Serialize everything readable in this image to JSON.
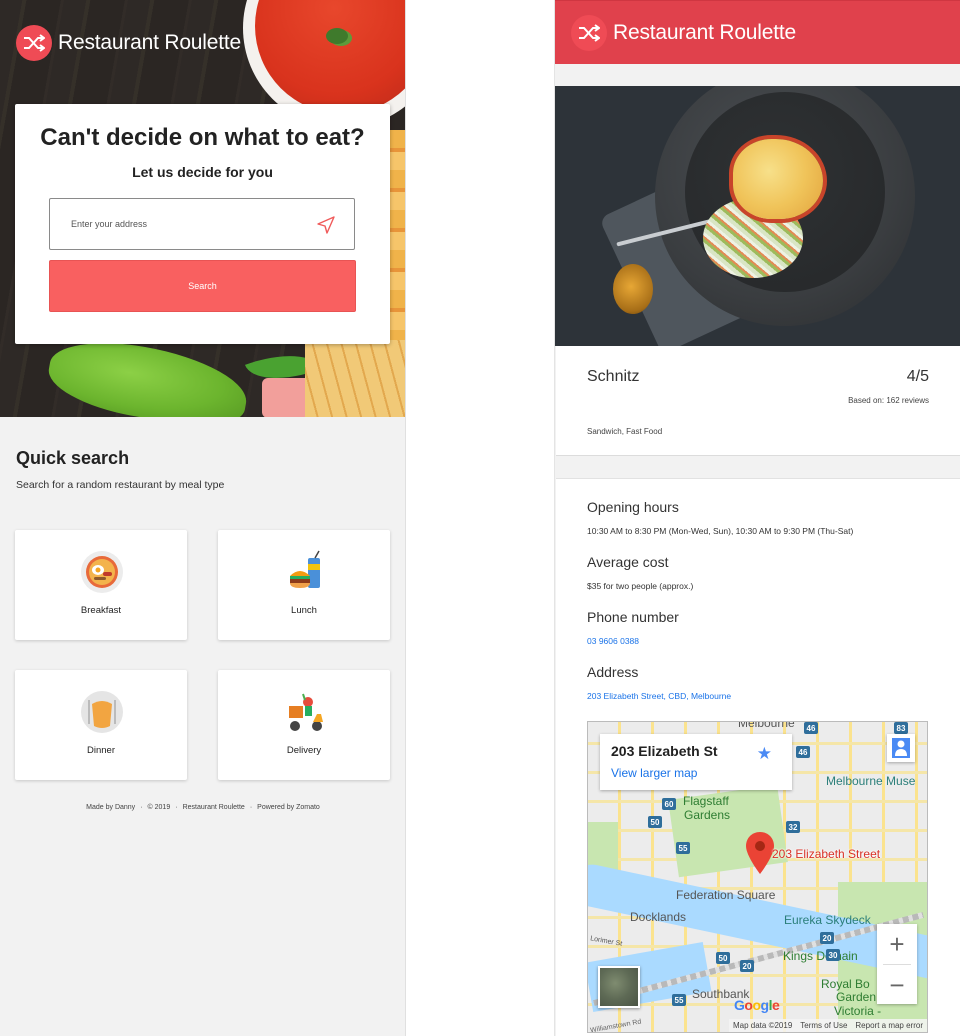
{
  "left": {
    "header": {
      "app_name": "Restaurant Roulette",
      "logo_icon": "shuffle-icon"
    },
    "hero": {
      "title": "Can't decide on what to eat?",
      "subtitle": "Let us decide for you",
      "address_placeholder": "Enter your address",
      "location_icon": "location-arrow-icon",
      "search_label": "Search"
    },
    "quick_search": {
      "title": "Quick search",
      "subtitle": "Search for a random restaurant by meal type",
      "items": [
        {
          "label": "Breakfast",
          "icon": "breakfast-icon"
        },
        {
          "label": "Lunch",
          "icon": "lunch-icon"
        },
        {
          "label": "Dinner",
          "icon": "dinner-icon"
        },
        {
          "label": "Delivery",
          "icon": "delivery-icon"
        }
      ]
    },
    "footer": {
      "made_by": "Made by Danny",
      "year": "© 2019",
      "app": "Restaurant Roulette",
      "powered": "Powered by Zomato"
    }
  },
  "right": {
    "header": {
      "app_name": "Restaurant Roulette"
    },
    "restaurant": {
      "name": "Schnitz",
      "rating": "4/5",
      "reviews": "Based on: 162 reviews",
      "cuisines": "Sandwich, Fast Food"
    },
    "details": {
      "hours_label": "Opening hours",
      "hours_value": "10:30 AM to 8:30 PM (Mon-Wed, Sun), 10:30 AM to 9:30 PM (Thu-Sat)",
      "cost_label": "Average cost",
      "cost_value": "$35 for two people (approx.)",
      "phone_label": "Phone number",
      "phone_value": "03 9606 0388",
      "address_label": "Address",
      "address_value": "203 Elizabeth Street, CBD, Melbourne"
    },
    "map": {
      "place_title": "203 Elizabeth St",
      "view_larger": "View larger map",
      "pin_label": "203 Elizabeth Street",
      "labels": {
        "melbourne_top": "Melbourne",
        "melbourne_museum": "Melbourne Muse",
        "flagstaff": "Flagstaff",
        "gardens": "Gardens",
        "federation": "Federation Square",
        "docklands": "Docklands",
        "eureka": "Eureka Skydeck",
        "kings_domain": "Kings Domain",
        "southbank": "Southbank",
        "royal_bot_1": "Royal Bo",
        "royal_bot_2": "Garden",
        "royal_bot_3": "Victoria -",
        "lorimer": "Lorimer St",
        "williamstown": "Williamstown Rd"
      },
      "routes": [
        "46",
        "83",
        "46",
        "60",
        "50",
        "32",
        "55",
        "30",
        "20",
        "50",
        "20",
        "55"
      ],
      "attribution": {
        "data": "Map data ©2019",
        "terms": "Terms of Use",
        "report": "Report a map error"
      },
      "google": "Google",
      "zoom_in": "+",
      "zoom_out": "−",
      "star": "★"
    }
  },
  "colors": {
    "brand_red": "#e0414c",
    "search_button": "#f96060",
    "link_blue": "#1a73e8",
    "background": "#f2f2f2"
  }
}
